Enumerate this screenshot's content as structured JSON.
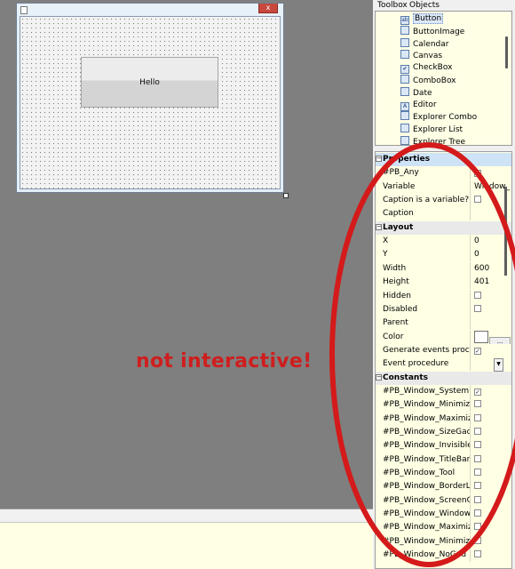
{
  "right_panel": {
    "tabs": [
      "Toolbox",
      "Objects"
    ]
  },
  "design_window": {
    "close_glyph": "x",
    "button_caption": "Hello"
  },
  "toolbox": {
    "items": [
      {
        "label": "Button",
        "icon": "button-icon",
        "glyph": "ab"
      },
      {
        "label": "ButtonImage",
        "icon": "button-image-icon",
        "glyph": ""
      },
      {
        "label": "Calendar",
        "icon": "calendar-icon",
        "glyph": ""
      },
      {
        "label": "Canvas",
        "icon": "canvas-icon",
        "glyph": ""
      },
      {
        "label": "CheckBox",
        "icon": "checkbox-icon",
        "glyph": "✔"
      },
      {
        "label": "ComboBox",
        "icon": "combobox-icon",
        "glyph": ""
      },
      {
        "label": "Date",
        "icon": "date-icon",
        "glyph": ""
      },
      {
        "label": "Editor",
        "icon": "editor-icon",
        "glyph": "A"
      },
      {
        "label": "Explorer Combo",
        "icon": "explorer-combo-icon",
        "glyph": ""
      },
      {
        "label": "Explorer List",
        "icon": "explorer-list-icon",
        "glyph": ""
      },
      {
        "label": "Explorer Tree",
        "icon": "explorer-tree-icon",
        "glyph": ""
      }
    ]
  },
  "properties": {
    "rows": [
      {
        "type": "section",
        "name": "Properties"
      },
      {
        "type": "check",
        "name": "#PB_Any",
        "checked": true
      },
      {
        "type": "text",
        "name": "Variable",
        "value": "Window_"
      },
      {
        "type": "check",
        "name": "Caption is a variable?",
        "checked": false
      },
      {
        "type": "text",
        "name": "Caption",
        "value": ""
      },
      {
        "type": "section",
        "name": "Layout"
      },
      {
        "type": "text",
        "name": "X",
        "value": "0"
      },
      {
        "type": "text",
        "name": "Y",
        "value": "0"
      },
      {
        "type": "text",
        "name": "Width",
        "value": "600"
      },
      {
        "type": "text",
        "name": "Height",
        "value": "401"
      },
      {
        "type": "check",
        "name": "Hidden",
        "checked": false
      },
      {
        "type": "check",
        "name": "Disabled",
        "checked": false
      },
      {
        "type": "text",
        "name": "Parent",
        "value": ""
      },
      {
        "type": "color",
        "name": "Color",
        "value": "..."
      },
      {
        "type": "check",
        "name": "Generate events proce",
        "checked": true
      },
      {
        "type": "dropdown",
        "name": "Event procedure",
        "value": ""
      },
      {
        "type": "section",
        "name": "Constants"
      },
      {
        "type": "check",
        "name": "#PB_Window_System",
        "checked": true
      },
      {
        "type": "check",
        "name": "#PB_Window_Minimiz",
        "checked": false
      },
      {
        "type": "check",
        "name": "#PB_Window_Maximiz",
        "checked": false
      },
      {
        "type": "check",
        "name": "#PB_Window_SizeGad",
        "checked": false
      },
      {
        "type": "check",
        "name": "#PB_Window_Invisible",
        "checked": false
      },
      {
        "type": "check",
        "name": "#PB_Window_TitleBar",
        "checked": false
      },
      {
        "type": "check",
        "name": "#PB_Window_Tool",
        "checked": false
      },
      {
        "type": "check",
        "name": "#PB_Window_BorderL",
        "checked": false
      },
      {
        "type": "check",
        "name": "#PB_Window_ScreenC",
        "checked": false
      },
      {
        "type": "check",
        "name": "#PB_Window_Window",
        "checked": false
      },
      {
        "type": "check",
        "name": "#PB_Window_Maximiz",
        "checked": false
      },
      {
        "type": "check",
        "name": "#PB_Window_Minimiz",
        "checked": false
      },
      {
        "type": "check",
        "name": "#PB_Window_NoGad",
        "checked": false
      }
    ]
  },
  "annotation": {
    "text": "not interactive!",
    "color": "#cf1e1e"
  },
  "colors": {
    "canvas_bg": "#7f7f7f",
    "panel_bg": "#ffffe4",
    "selection": "#cfe3f7"
  }
}
